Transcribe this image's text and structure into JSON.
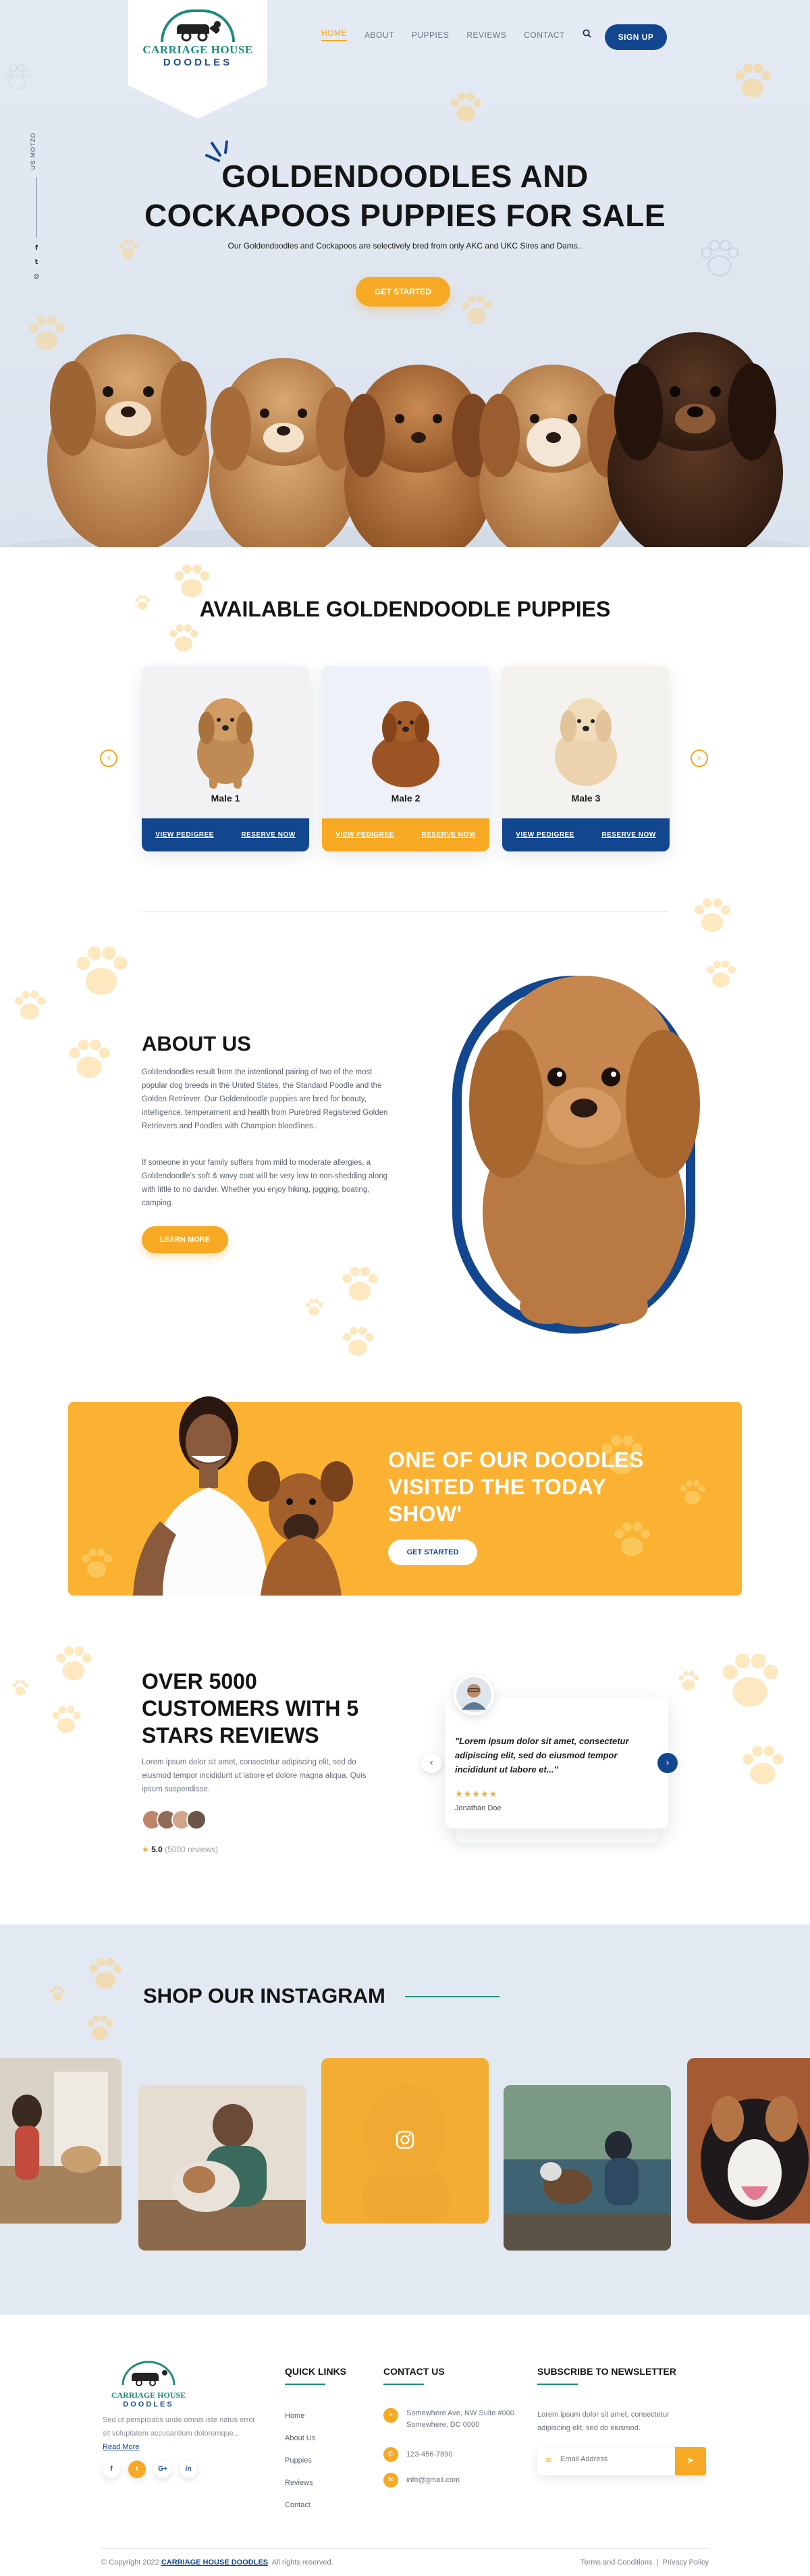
{
  "nav": {
    "links": [
      "HOME",
      "ABOUT",
      "PUPPIES",
      "REVIEWS",
      "CONTACT"
    ],
    "signup": "SIGN UP"
  },
  "logo": {
    "line1": "CARRIAGE HOUSE",
    "line2": "DOODLES"
  },
  "side": {
    "label": "US MOTZO"
  },
  "hero": {
    "title_line1": "GOLDENDOODLES AND",
    "title_line2": "COCKAPOOS PUPPIES FOR SALE",
    "subtitle": "Our Goldendoodles and Cockapoos are selectively bred from only AKC and UKC Sires and Dams..",
    "cta": "GET STARTED"
  },
  "available": {
    "title": "AVAILABLE GOLDENDOODLE PUPPIES",
    "cards": [
      {
        "name": "Male 1",
        "pedigree": "VIEW PEDIGREE",
        "reserve": "RESERVE NOW"
      },
      {
        "name": "Male 2",
        "pedigree": "VIEW PEDIGREE",
        "reserve": "RESERVE NOW"
      },
      {
        "name": "Male 3",
        "pedigree": "VIEW PEDIGREE",
        "reserve": "RESERVE NOW"
      }
    ]
  },
  "about": {
    "title": "ABOUT US",
    "p1": "Goldendoodles result from the intentional pairing of two of the most popular dog breeds in the United States, the Standard Poodle and the Golden Retriever. Our Goldendoodle puppies are bred for beauty, intelligence, temperament and health from Purebred Registered Golden Retrievers and Poodles with Champion bloodlines..",
    "p2": "If someone in your family suffers from mild to moderate allergies, a Goldendoodle's soft & wavy coat will be very low to non-shedding along with little to no dander. Whether you enjoy hiking, jogging, boating, camping.",
    "cta": "LEARN MORE"
  },
  "today": {
    "title": "ONE OF OUR DOODLES VISITED THE TODAY SHOW'",
    "cta": "GET STARTED"
  },
  "reviews": {
    "title": "OVER 5000 CUSTOMERS WITH 5 STARS REVIEWS",
    "text": "Lorem ipsum dolor sit amet, consectetur adipiscing elit, sed do eiusmod tempor incididunt ut labore et dolore magna aliqua. Quis ipsum suspendisse.",
    "rating": "5.0",
    "count": "(5000 reviews)",
    "quote": "\"Lorem ipsum dolor sit amet, consectetur adipiscing elit, sed do eiusmod tempor incididunt ut labore et...\"",
    "stars": "★★★★★",
    "name": "Jonathan Doe"
  },
  "instagram": {
    "title": "SHOP OUR INSTAGRAM"
  },
  "footer": {
    "desc": "Sed ut perspiciatis unde omnis iste natus error sit voluptatem accusantium doloremque...",
    "read_more": "Read More",
    "quick_links_title": "QUICK LINKS",
    "quick_links": [
      "Home",
      "About Us",
      "Puppies",
      "Reviews",
      "Contact"
    ],
    "contact_title": "CONTACT US",
    "address": "Somewhere Ave, NW Suite #000 Somewhere, DC 0000",
    "phone": "123-456-7890",
    "email": "info@gmail.com",
    "newsletter_title": "SUBSCRIBE TO NEWSLETTER",
    "newsletter_text": "Lorem ipsum dolor sit amet, consectetur adipiscing elit, sed do eiusmod.",
    "email_placeholder": "Email Address",
    "copyright_pre": "© Copyright 2022",
    "copyright_brand": "CARRIAGE HOUSE DOODLES",
    "copyright_post": ". All rights reserved.",
    "terms": "Terms and Conditions",
    "privacy": "Privacy Policy"
  }
}
